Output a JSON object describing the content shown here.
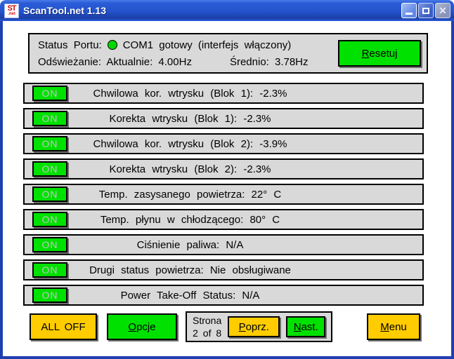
{
  "window": {
    "title": "ScanTool.net 1.13",
    "app_icon_text": "ST",
    "app_icon_subtext": ".net"
  },
  "titlebar": {
    "close_glyph": "✕"
  },
  "status_panel": {
    "port_label": "Status Portu:",
    "port_value": "COM1 gotowy (interfejs włączony)",
    "refresh_text": "Odświeżanie: Aktualnie: 4.00Hz",
    "average_text": "Średnio: 3.78Hz",
    "reset_button": "Resetuj",
    "indicator_color": "#00d800"
  },
  "sensors": {
    "rows": [
      {
        "toggle": "ON",
        "text": "Chwilowa kor. wtrysku (Blok 1): -2.3%"
      },
      {
        "toggle": "ON",
        "text": "Korekta wtrysku (Blok 1): -2.3%"
      },
      {
        "toggle": "ON",
        "text": "Chwilowa kor. wtrysku (Blok 2): -3.9%"
      },
      {
        "toggle": "ON",
        "text": "Korekta wtrysku (Blok 2): -2.3%"
      },
      {
        "toggle": "ON",
        "text": "Temp. zasysanego powietrza: 22° C"
      },
      {
        "toggle": "ON",
        "text": "Temp. płynu w chłodzącego: 80° C"
      },
      {
        "toggle": "ON",
        "text": "Ciśnienie paliwa: N/A"
      },
      {
        "toggle": "ON",
        "text": "Drugi status powietrza: Nie obsługiwane"
      },
      {
        "toggle": "ON",
        "text": "Power Take-Off Status: N/A"
      }
    ]
  },
  "footer": {
    "all_off_button": "ALL OFF",
    "options_button": "Opcje",
    "page_word": "Strona",
    "page_number": "2 of 8",
    "prev_button": "Poprz.",
    "next_button": "Nast.",
    "menu_button": "Menu"
  },
  "colors": {
    "accent_green": "#00e100",
    "accent_yellow": "#ffcc00",
    "panel_gray": "#d9d9d9",
    "titlebar_blue": "#2a5ade",
    "window_border_blue": "#1e3faf"
  }
}
